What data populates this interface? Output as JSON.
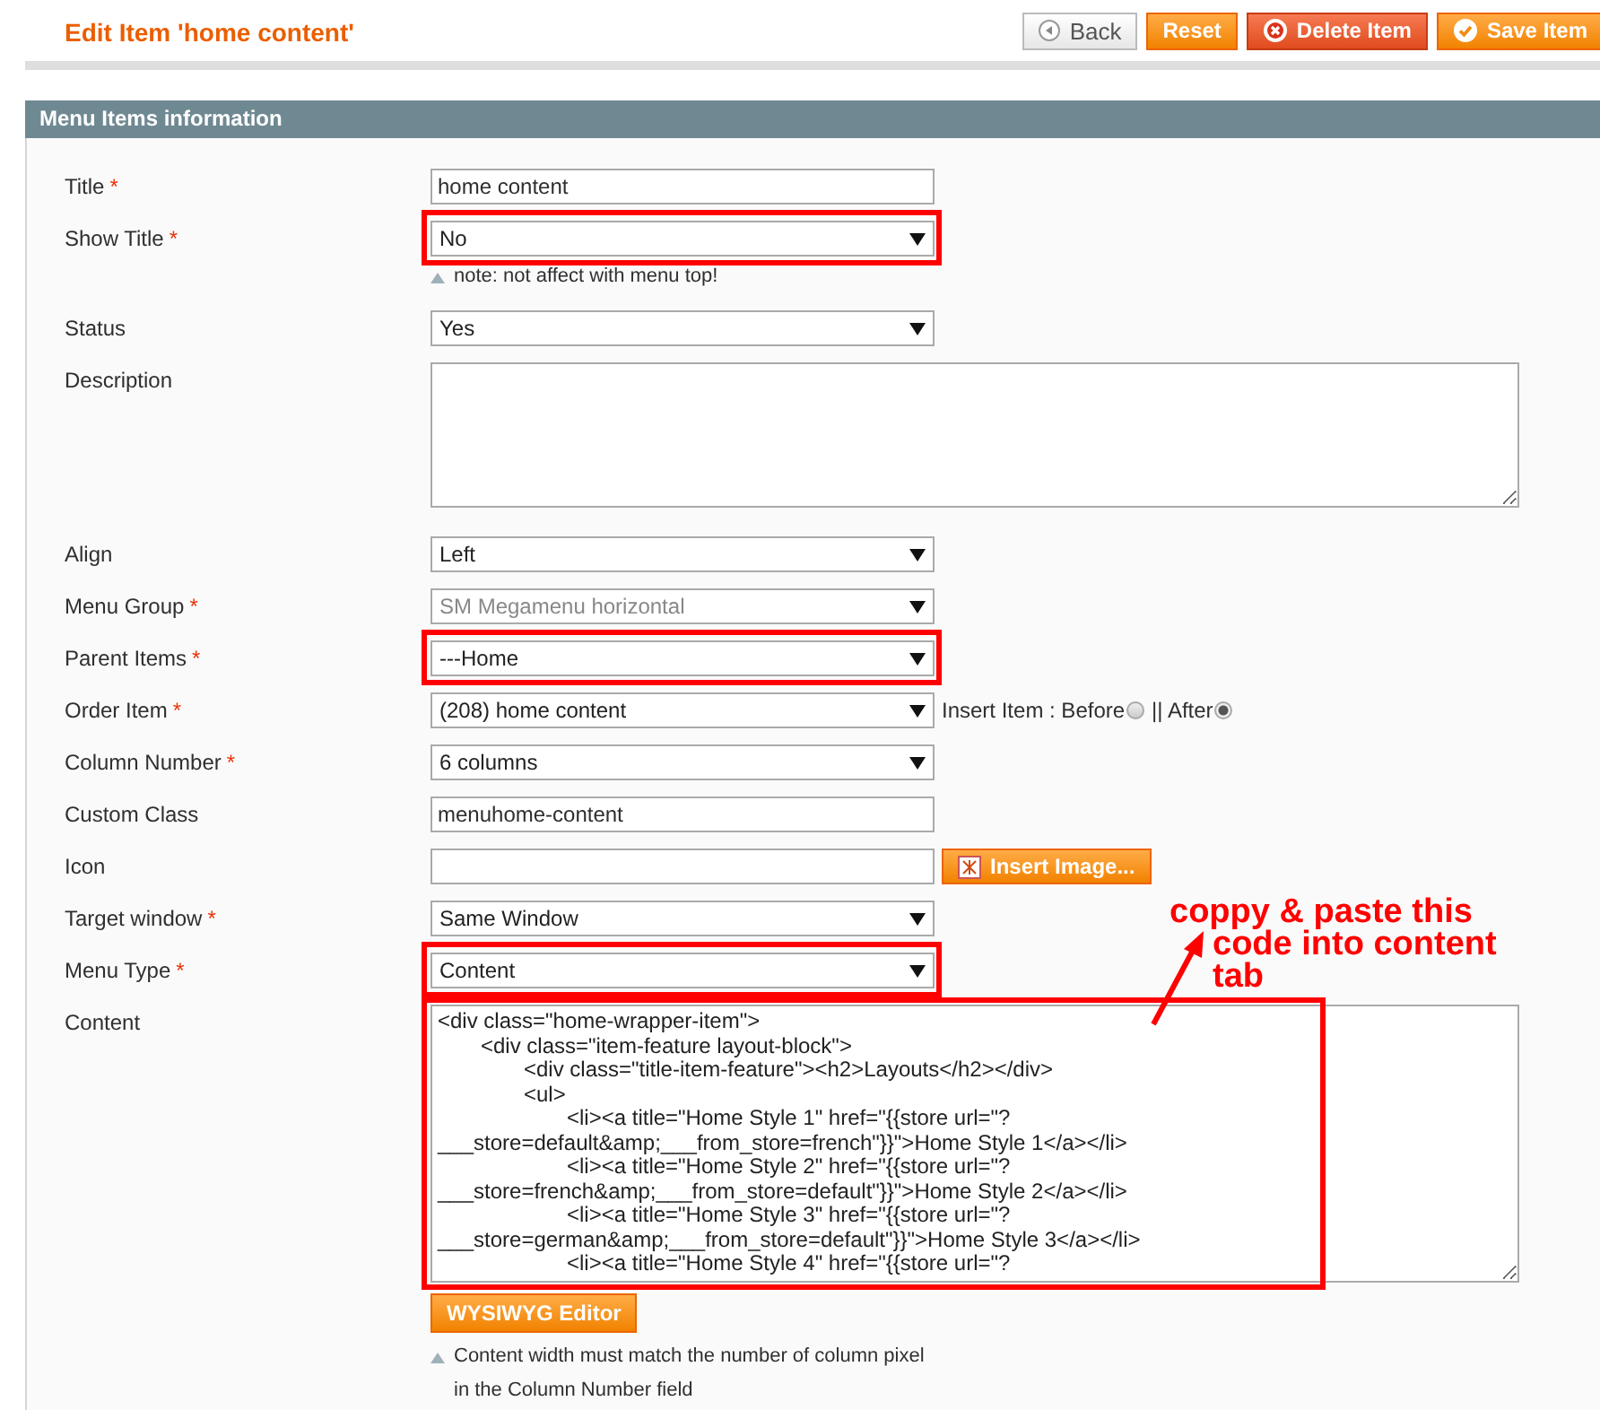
{
  "page_title": "Edit Item 'home content'",
  "buttons": [
    {
      "kind": "back",
      "label": "Back"
    },
    {
      "kind": "reset",
      "label": "Reset"
    },
    {
      "kind": "delete",
      "label": "Delete Item"
    },
    {
      "kind": "save",
      "label": "Save Item"
    }
  ],
  "section": {
    "title": "Menu Items information",
    "fields": [
      {
        "label": "Title",
        "required_mark": "*",
        "kind": "text",
        "value": "home content",
        "disabled": false,
        "highlighted": false
      },
      {
        "label": "Show Title",
        "required_mark": "*",
        "kind": "select",
        "value": "No",
        "disabled": false,
        "highlighted": true,
        "note": [
          "note: not affect with menu top!"
        ]
      },
      {
        "label": "Status",
        "kind": "select",
        "value": "Yes",
        "disabled": false,
        "highlighted": false
      },
      {
        "label": "Description",
        "kind": "textarea",
        "disabled": false,
        "highlighted": false
      },
      {
        "label": "Align",
        "kind": "select",
        "value": "Left",
        "disabled": false,
        "highlighted": false
      },
      {
        "label": "Menu Group",
        "required_mark": "*",
        "kind": "select",
        "value": "SM Megamenu horizontal",
        "disabled": true,
        "highlighted": false
      },
      {
        "label": "Parent Items",
        "required_mark": "*",
        "kind": "select",
        "value": "---Home",
        "disabled": false,
        "highlighted": true
      },
      {
        "label": "Order Item",
        "required_mark": "*",
        "kind": "select",
        "value": "(208) home content",
        "disabled": false,
        "highlighted": false,
        "radios": [
          {
            "label": "Insert Item : Before",
            "selected": false
          },
          {
            "label": "|| After",
            "selected": true
          }
        ]
      },
      {
        "label": "Column Number",
        "required_mark": "*",
        "kind": "select",
        "value": "6 columns",
        "disabled": false,
        "highlighted": false
      },
      {
        "label": "Custom Class",
        "kind": "text",
        "value": "menuhome-content",
        "disabled": false,
        "highlighted": false
      },
      {
        "label": "Icon",
        "kind": "text",
        "disabled": false,
        "highlighted": false,
        "button": "Insert Image..."
      },
      {
        "label": "Target window",
        "required_mark": "*",
        "kind": "select",
        "value": "Same Window",
        "disabled": false,
        "highlighted": false
      },
      {
        "label": "Menu Type",
        "required_mark": "*",
        "kind": "select",
        "value": "Content",
        "disabled": false,
        "highlighted": true
      },
      {
        "label": "Content",
        "kind": "editor",
        "disabled": false,
        "highlighted": true,
        "value": "<div class=\"home-wrapper-item\">\n\t<div class=\"item-feature layout-block\">\n\t\t<div class=\"title-item-feature\"><h2>Layouts</h2></div>\n\t\t<ul>\n\t\t\t<li><a title=\"Home Style 1\" href=\"{{store url=\"?___store=default&amp;___from_store=french\"}}\">Home Style 1</a></li>\n\t\t\t<li><a title=\"Home Style 2\" href=\"{{store url=\"?___store=french&amp;___from_store=default\"}}\">Home Style 2</a></li>\n\t\t\t<li><a title=\"Home Style 3\" href=\"{{store url=\"?___store=german&amp;___from_store=default\"}}\">Home Style 3</a></li>\n\t\t\t<li><a title=\"Home Style 4\" href=\"{{store url=\"?",
        "button": "WYSIWYG Editor",
        "note": [
          "Content width must match the number of column pixel",
          "in the Column Number field"
        ]
      }
    ]
  },
  "annotation": {
    "lines": [
      "coppy & paste this",
      "code into content",
      "tab"
    ]
  }
}
